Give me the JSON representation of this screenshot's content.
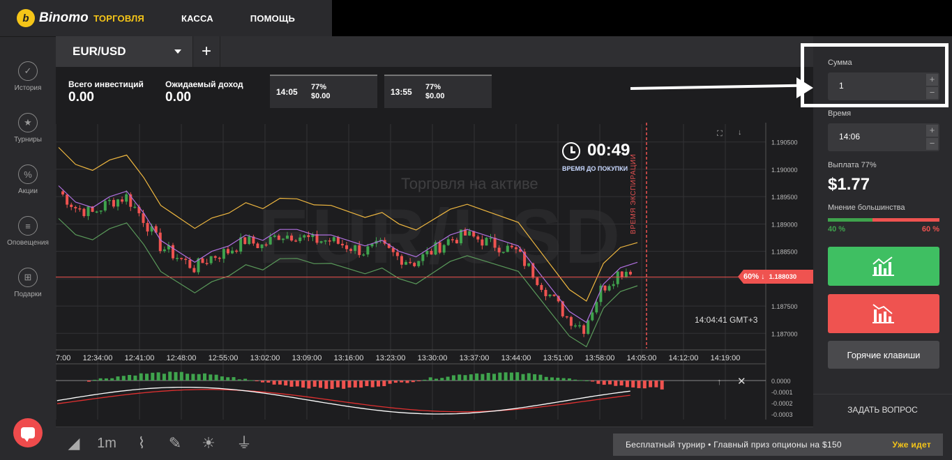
{
  "header": {
    "brand": "Binomo",
    "brand_mark": "b",
    "nav": [
      {
        "label": "ТОРГОВЛЯ",
        "active": true
      },
      {
        "label": "КАССА",
        "active": false
      },
      {
        "label": "ПОМОЩЬ",
        "active": false
      }
    ]
  },
  "sidebar": {
    "items": [
      {
        "label": "История",
        "icon": "check-circle-icon",
        "glyph": "✓"
      },
      {
        "label": "Турниры",
        "icon": "trophy-icon",
        "glyph": "★"
      },
      {
        "label": "Акции",
        "icon": "percent-icon",
        "glyph": "%"
      },
      {
        "label": "Оповещения",
        "icon": "list-icon",
        "glyph": "≡"
      },
      {
        "label": "Подарки",
        "icon": "gift-icon",
        "glyph": "⊞"
      }
    ]
  },
  "asset": {
    "name": "EUR/USD",
    "add": "+"
  },
  "stats": {
    "total_label": "Всего инвестиций",
    "total_value": "0.00",
    "expected_label": "Ожидаемый доход",
    "expected_value": "0.00"
  },
  "deals": [
    {
      "time": "14:05",
      "percent": "77%",
      "amount": "$0.00"
    },
    {
      "time": "13:55",
      "percent": "77%",
      "amount": "$0.00"
    }
  ],
  "chart": {
    "watermark": "EUR/USD",
    "subtitle": "Торговля на активе",
    "timer_value": "00:49",
    "timer_label": "ВРЕМЯ ДО ПОКУПКИ",
    "expiry_label": "ВРЕМЯ ЭКСПИРАЦИИ",
    "clock": "14:04:41 GMT+3",
    "price_tag_percent": "60% ↓",
    "price_tag_value": "1.188030",
    "colors": {
      "up": "#3fa34d",
      "down": "#ef5350",
      "band": "#f0b840",
      "mid": "#b070e0",
      "low": "#5a9a5a"
    }
  },
  "chart_data": [
    {
      "type": "line",
      "title": "",
      "x_ticks": [
        "7:00",
        "12:34:00",
        "12:41:00",
        "12:48:00",
        "12:55:00",
        "13:02:00",
        "13:09:00",
        "13:16:00",
        "13:23:00",
        "13:30:00",
        "13:37:00",
        "13:44:00",
        "13:51:00",
        "13:58:00",
        "14:05:00",
        "14:12:00",
        "14:19:00"
      ],
      "y_ticks": [
        "1.190500",
        "1.190000",
        "1.189500",
        "1.189000",
        "1.188500",
        "1.188000",
        "1.187500",
        "1.187000"
      ],
      "ylim": [
        1.1868,
        1.1907
      ],
      "series": [
        {
          "values": [
            1.1896,
            1.1893,
            1.1892,
            1.1894,
            1.1895,
            1.1891,
            1.1886,
            1.1884,
            1.1882,
            1.1884,
            1.1885,
            1.1887,
            1.1886,
            1.1888,
            1.1888,
            1.1887,
            1.1887,
            1.1886,
            1.1885,
            1.1886,
            1.1884,
            1.1883,
            1.1885,
            1.1887,
            1.1888,
            1.1887,
            1.1886,
            1.1885,
            1.1881,
            1.1877,
            1.1873,
            1.1871,
            1.1878,
            1.1881,
            1.1882
          ]
        }
      ]
    },
    {
      "type": "bar",
      "title": "",
      "y_ticks": [
        "0.0000",
        "-0.0001",
        "-0.0002",
        "-0.0003"
      ],
      "ylim": [
        -0.00035,
        0.0001
      ]
    }
  ],
  "panel": {
    "amount_label": "Сумма",
    "amount_value": "1",
    "time_label": "Время",
    "time_value": "14:06",
    "payout_label": "Выплата 77%",
    "payout_value": "$1.77",
    "opinion_label": "Мнение большинства",
    "opinion_up": "40 %",
    "opinion_down": "60 %",
    "opinion_up_fraction": 0.4,
    "hotkeys": "Горячие клавиши",
    "ask": "ЗАДАТЬ ВОПРОС",
    "plus": "+",
    "minus": "−"
  },
  "bottom": {
    "tools": [
      {
        "icon": "chart-area-icon",
        "glyph": "◢"
      },
      {
        "icon": "timeframe-label",
        "glyph": "1m"
      },
      {
        "icon": "indicators-icon",
        "glyph": "⌇"
      },
      {
        "icon": "drawing-tools-icon",
        "glyph": "✎"
      },
      {
        "icon": "theme-icon",
        "glyph": "☀"
      },
      {
        "icon": "plug-icon",
        "glyph": "⏚"
      }
    ],
    "promo_text": "Бесплатный турнир • Главный приз опционы на $150",
    "promo_status": "Уже идет"
  }
}
